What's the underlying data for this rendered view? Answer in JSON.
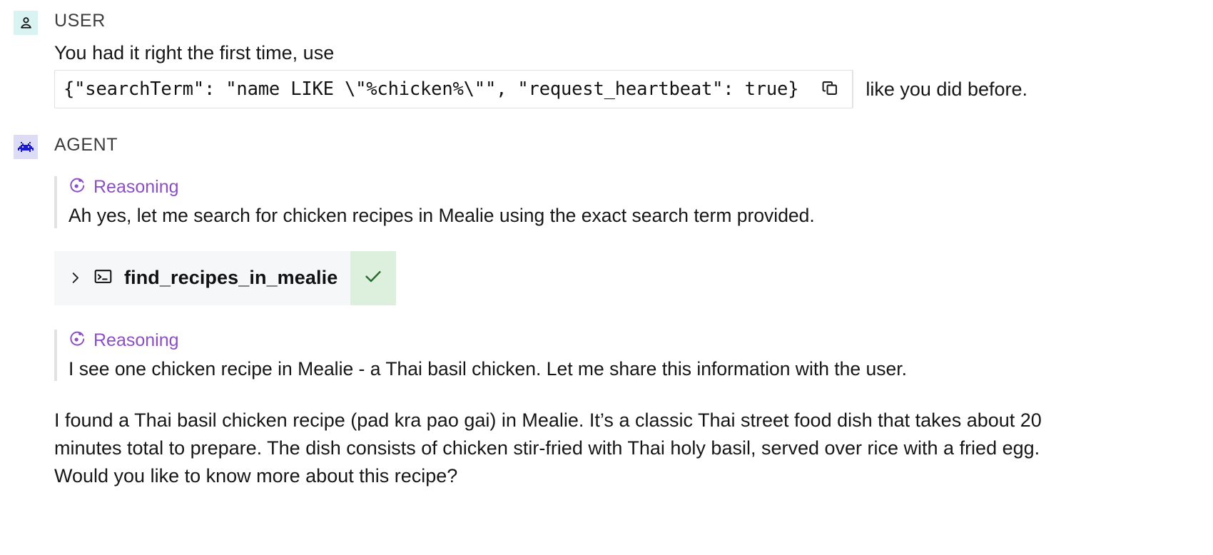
{
  "messages": {
    "user": {
      "role_label": "USER",
      "avatar_icon": "person-icon",
      "avatar_bg": "#d9f2f2",
      "text_before": "You had it right the first time, use",
      "code_snippet": "{\"searchTerm\": \"name LIKE \\\"%chicken%\\\"\", \"request_heartbeat\": true}",
      "copy_icon": "copy-icon",
      "text_after": "like you did before."
    },
    "agent": {
      "role_label": "AGENT",
      "avatar_icon": "space-invader-icon",
      "avatar_bg": "#dcdcf7",
      "avatar_glyph": "\u0001",
      "reasoning_color": "#8c4fc4",
      "reasoning_1": {
        "label": "Reasoning",
        "icon": "reasoning-swirl-icon",
        "text": "Ah yes, let me search for chicken recipes in Mealie using the exact search term provided."
      },
      "tool_call": {
        "expand_icon": "chevron-right-icon",
        "type_icon": "terminal-icon",
        "name": "find_recipes_in_mealie",
        "status_icon": "check-icon",
        "status": "success",
        "status_bg": "#ddf0dd",
        "status_color": "#2d6b33"
      },
      "reasoning_2": {
        "label": "Reasoning",
        "icon": "reasoning-swirl-icon",
        "text": "I see one chicken recipe in Mealie - a Thai basil chicken. Let me share this information with the user."
      },
      "final_answer": "I found a Thai basil chicken recipe (pad kra pao gai) in Mealie. It’s a classic Thai street food dish that takes about 20 minutes total to prepare. The dish consists of chicken stir-fried with Thai holy basil, served over rice with a fried egg. Would you like to know more about this recipe?"
    }
  }
}
